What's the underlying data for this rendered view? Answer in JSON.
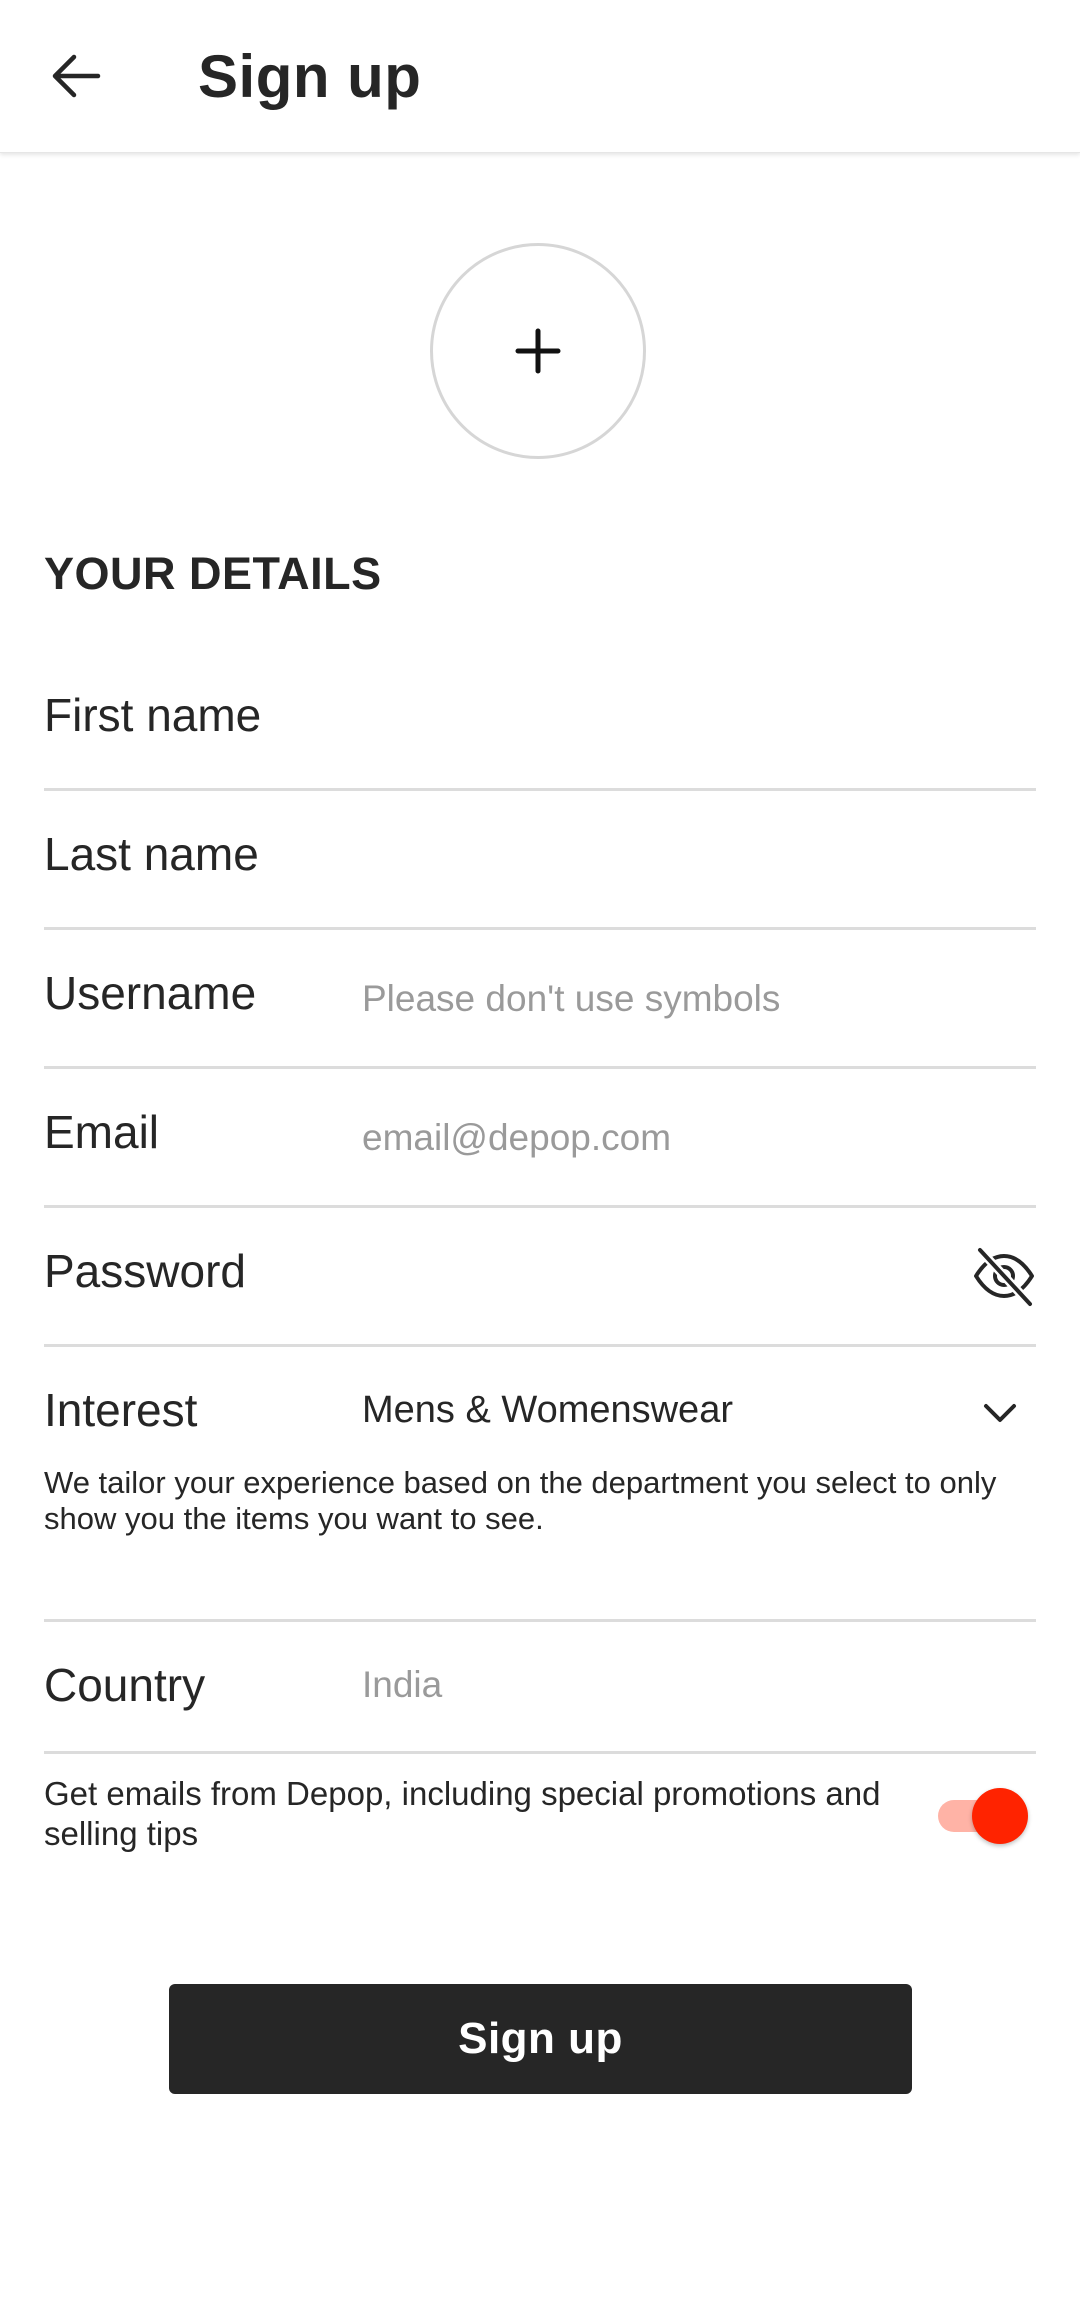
{
  "header": {
    "back_icon": "arrow-left-icon",
    "title": "Sign up"
  },
  "avatar": {
    "icon": "plus-icon"
  },
  "section": {
    "title": "YOUR DETAILS"
  },
  "fields": {
    "first_name": {
      "label": "First name",
      "value": ""
    },
    "last_name": {
      "label": "Last name",
      "value": ""
    },
    "username": {
      "label": "Username",
      "placeholder": "Please don't use symbols"
    },
    "email": {
      "label": "Email",
      "placeholder": "email@depop.com"
    },
    "password": {
      "label": "Password",
      "icon": "eye-off-icon"
    },
    "interest": {
      "label": "Interest",
      "value": "Mens & Womenswear",
      "icon": "chevron-down-icon",
      "helper": "We tailor your experience based on the department you select to only show you the items you want to see."
    },
    "country": {
      "label": "Country",
      "placeholder": "India"
    }
  },
  "marketing": {
    "text": "Get emails from Depop, including special promotions and selling tips",
    "enabled": true,
    "accent": "#ff2300"
  },
  "primary_button": {
    "label": "Sign up",
    "color": "#262626"
  }
}
